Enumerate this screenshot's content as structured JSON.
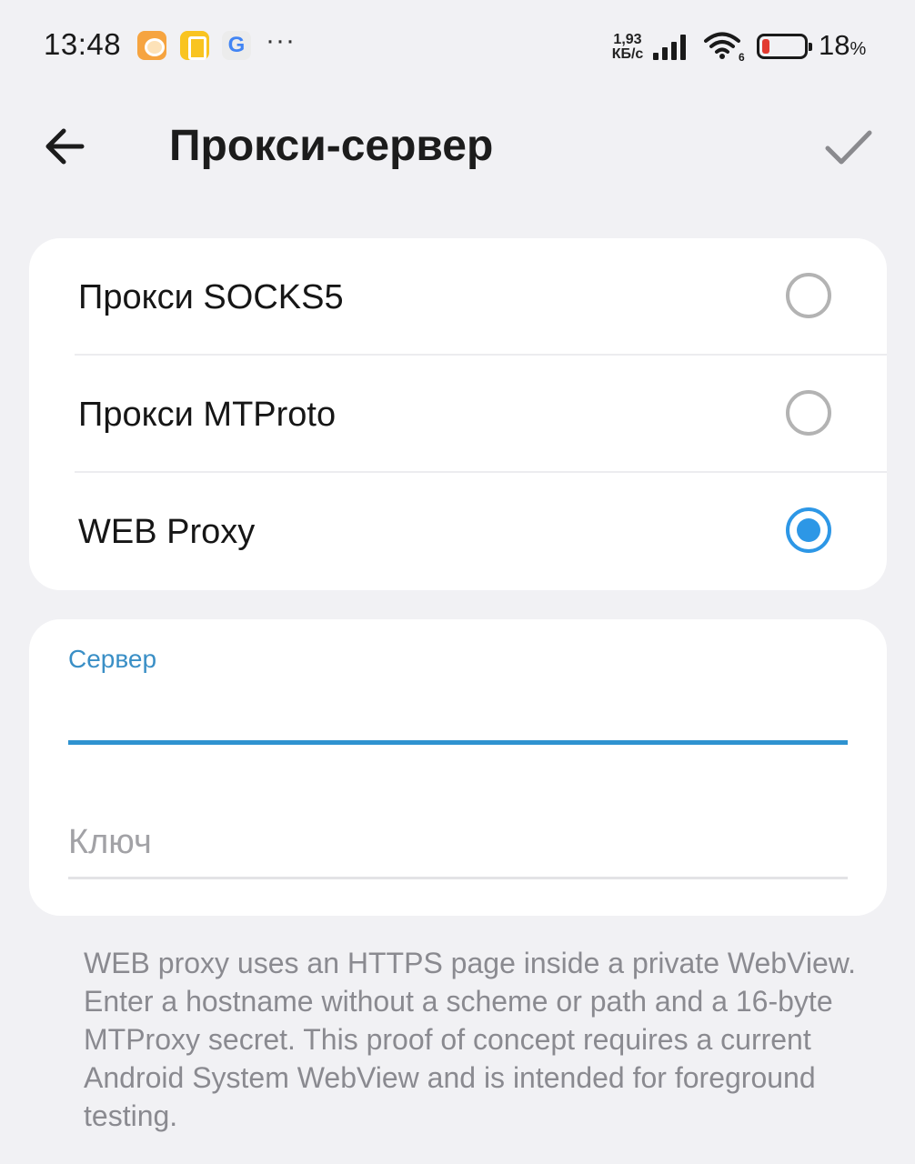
{
  "status_bar": {
    "time": "13:48",
    "app_icons": [
      "orange-chat-icon",
      "yellow-app-icon",
      "google-icon"
    ],
    "more": "···",
    "google_letter": "G",
    "speed_value": "1,93",
    "speed_unit": "КБ/с",
    "wifi_badge": "6",
    "battery_percent": "18",
    "battery_percent_sign": "%",
    "battery_level": 0.18,
    "battery_color": "#e23a30"
  },
  "appbar": {
    "title": "Прокси-сервер"
  },
  "proxy_types": {
    "options": [
      {
        "label": "Прокси SOCKS5",
        "selected": false
      },
      {
        "label": "Прокси MTProto",
        "selected": false
      },
      {
        "label": "WEB Proxy",
        "selected": true
      }
    ]
  },
  "form": {
    "server": {
      "label": "Сервер",
      "value": "",
      "placeholder": ""
    },
    "key": {
      "label": "",
      "value": "",
      "placeholder": "Ключ"
    }
  },
  "help_text": "WEB proxy uses an HTTPS page inside a private WebView. Enter a hostname without a scheme or path and a 16-byte MTProxy secret. This proof of concept requires a current Android System WebView and is intended for foreground testing.",
  "colors": {
    "accent": "#2d97e6",
    "background": "#f1f1f4",
    "card": "#ffffff"
  }
}
